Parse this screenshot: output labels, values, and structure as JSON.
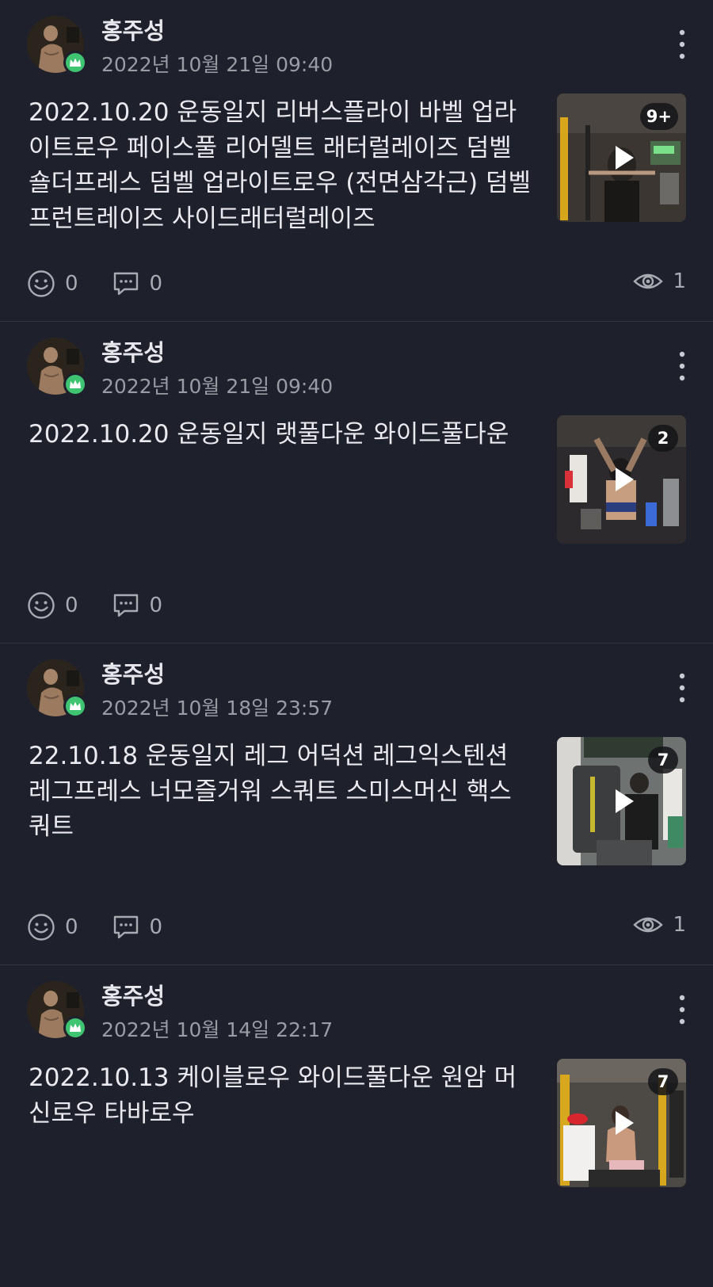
{
  "colors": {
    "background": "#1e202b",
    "divider": "#33363f",
    "badge_green": "#3fc472",
    "secondary_text": "#9a9ca5"
  },
  "icons": {
    "badge": "crown-icon",
    "menu": "more-vertical-icon",
    "play": "play-icon",
    "reaction": "smiley-icon",
    "comment": "comment-icon",
    "views": "eye-icon"
  },
  "posts": [
    {
      "author": "홍주성",
      "timestamp": "2022년 10월 21일 09:40",
      "text": "2022.10.20 운동일지 리버스플라이 바벨 업라이트로우 페이스풀 리어델트 래터럴레이즈 덤벨 숄더프레스 덤벨 업라이트로우 (전면삼각근) 덤벨 프런트레이즈 사이드래터럴레이즈",
      "media_count": "9+",
      "reactions": "0",
      "comments": "0",
      "views": "1"
    },
    {
      "author": "홍주성",
      "timestamp": "2022년 10월 21일 09:40",
      "text": "2022.10.20 운동일지 랫풀다운 와이드풀다운",
      "media_count": "2",
      "reactions": "0",
      "comments": "0",
      "views": ""
    },
    {
      "author": "홍주성",
      "timestamp": "2022년 10월 18일 23:57",
      "text": "22.10.18 운동일지 레그 어덕션 레그익스텐션 레그프레스 너모즐거워 스쿼트 스미스머신 핵스쿼트",
      "media_count": "7",
      "reactions": "0",
      "comments": "0",
      "views": "1"
    },
    {
      "author": "홍주성",
      "timestamp": "2022년 10월 14일 22:17",
      "text": "2022.10.13 케이블로우 와이드풀다운 원암 머신로우 타바로우",
      "media_count": "7",
      "reactions": "",
      "comments": "",
      "views": ""
    }
  ]
}
